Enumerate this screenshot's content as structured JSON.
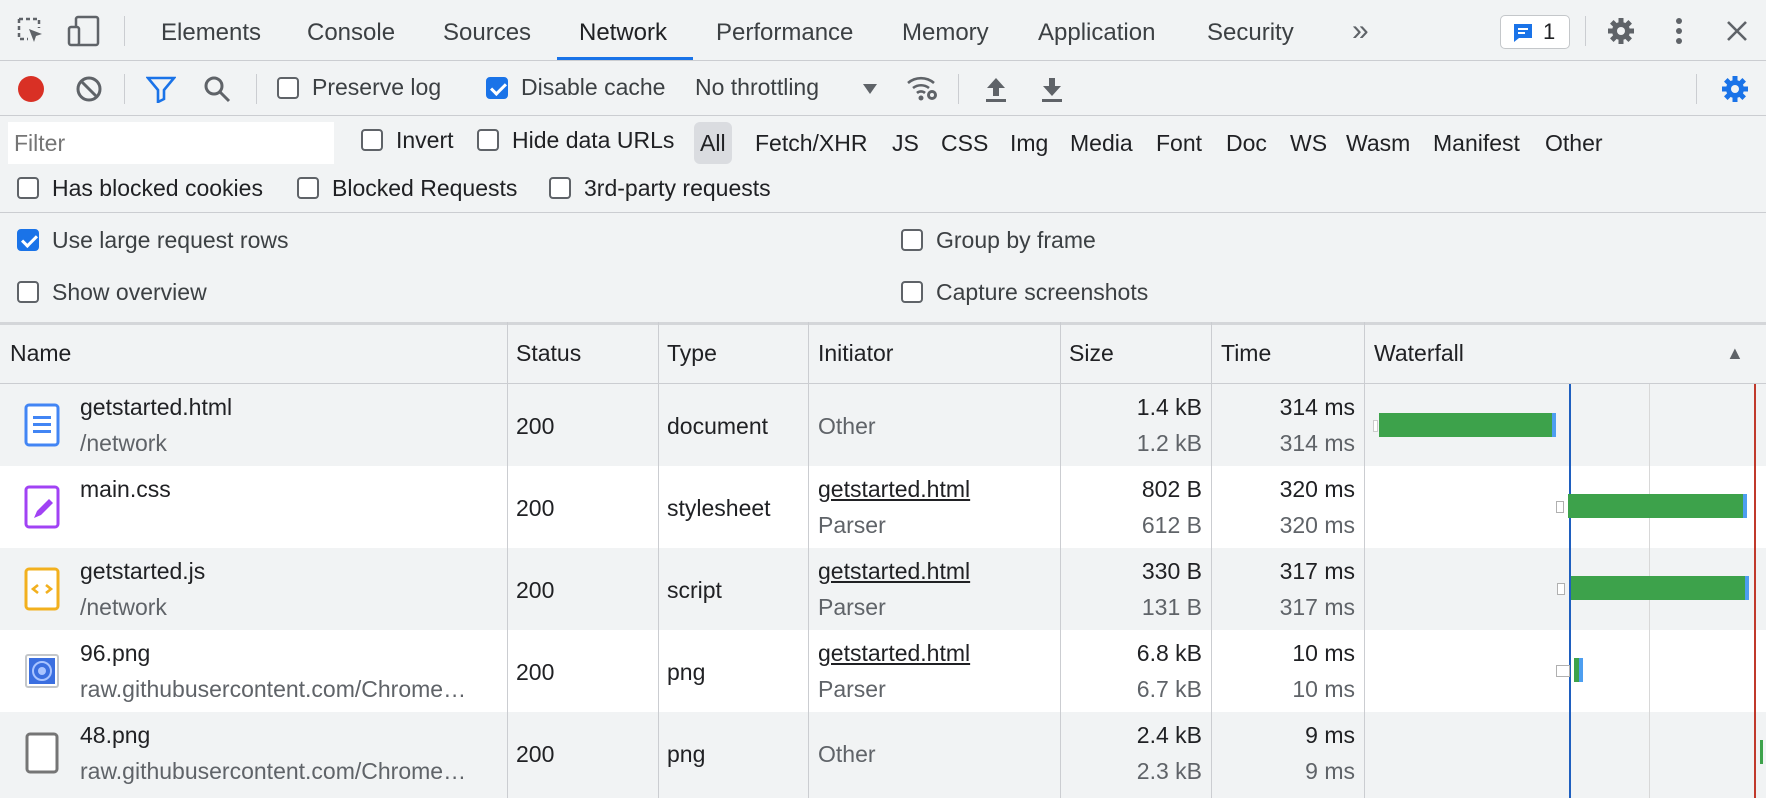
{
  "tabs": {
    "items": [
      {
        "label": "Elements"
      },
      {
        "label": "Console"
      },
      {
        "label": "Sources"
      },
      {
        "label": "Network"
      },
      {
        "label": "Performance"
      },
      {
        "label": "Memory"
      },
      {
        "label": "Application"
      },
      {
        "label": "Security"
      }
    ],
    "active": "Network",
    "more_glyph": "»",
    "issues_count": "1"
  },
  "toolbar": {
    "preserve_log": {
      "label": "Preserve log",
      "checked": false
    },
    "disable_cache": {
      "label": "Disable cache",
      "checked": true
    },
    "throttling": "No throttling"
  },
  "filter": {
    "placeholder": "Filter",
    "value": "",
    "invert": {
      "label": "Invert",
      "checked": false
    },
    "hide_data_urls": {
      "label": "Hide data URLs",
      "checked": false
    },
    "types": [
      "All",
      "Fetch/XHR",
      "JS",
      "CSS",
      "Img",
      "Media",
      "Font",
      "Doc",
      "WS",
      "Wasm",
      "Manifest",
      "Other"
    ],
    "selected_type": "All",
    "has_blocked_cookies": {
      "label": "Has blocked cookies",
      "checked": false
    },
    "blocked_requests": {
      "label": "Blocked Requests",
      "checked": false
    },
    "third_party": {
      "label": "3rd-party requests",
      "checked": false
    }
  },
  "settings": {
    "large_rows": {
      "label": "Use large request rows",
      "checked": true
    },
    "group_by_frame": {
      "label": "Group by frame",
      "checked": false
    },
    "show_overview": {
      "label": "Show overview",
      "checked": false
    },
    "capture_screenshots": {
      "label": "Capture screenshots",
      "checked": false
    }
  },
  "table": {
    "columns": [
      "Name",
      "Status",
      "Type",
      "Initiator",
      "Size",
      "Time",
      "Waterfall"
    ],
    "sort_glyph": "▲",
    "rows": [
      {
        "icon": "document-icon",
        "name": "getstarted.html",
        "path": "/network",
        "status": "200",
        "type": "document",
        "initiator": "Other",
        "initiator_link": false,
        "initiator_sub": "",
        "size": "1.4 kB",
        "resource_size": "1.2 kB",
        "time": "314 ms",
        "latency": "314 ms"
      },
      {
        "icon": "stylesheet-icon",
        "name": "main.css",
        "path": "",
        "status": "200",
        "type": "stylesheet",
        "initiator": "getstarted.html",
        "initiator_link": true,
        "initiator_sub": "Parser",
        "size": "802 B",
        "resource_size": "612 B",
        "time": "320 ms",
        "latency": "320 ms"
      },
      {
        "icon": "script-icon",
        "name": "getstarted.js",
        "path": "/network",
        "status": "200",
        "type": "script",
        "initiator": "getstarted.html",
        "initiator_link": true,
        "initiator_sub": "Parser",
        "size": "330 B",
        "resource_size": "131 B",
        "time": "317 ms",
        "latency": "317 ms"
      },
      {
        "icon": "image-icon",
        "name": "96.png",
        "path": "raw.githubusercontent.com/Chrome…",
        "status": "200",
        "type": "png",
        "initiator": "getstarted.html",
        "initiator_link": true,
        "initiator_sub": "Parser",
        "size": "6.8 kB",
        "resource_size": "6.7 kB",
        "time": "10 ms",
        "latency": "10 ms"
      },
      {
        "icon": "image-placeholder-icon",
        "name": "48.png",
        "path": "raw.githubusercontent.com/Chrome…",
        "status": "200",
        "type": "png",
        "initiator": "Other",
        "initiator_link": false,
        "initiator_sub": "",
        "size": "2.4 kB",
        "resource_size": "2.3 kB",
        "time": "9 ms",
        "latency": "9 ms"
      }
    ]
  },
  "colors": {
    "accent": "#1a73e8",
    "record": "#d93025",
    "waterfall_bar": "#3da24b",
    "row_alt": "#f1f3f4"
  }
}
